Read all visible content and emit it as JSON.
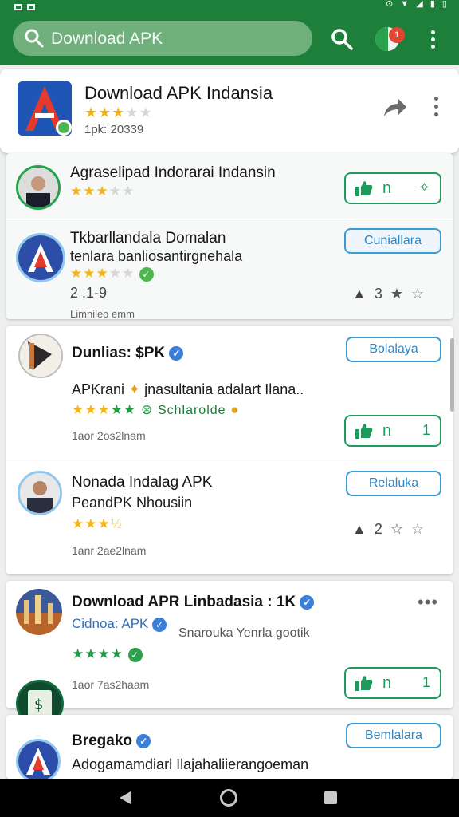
{
  "search": {
    "query": "Download APK"
  },
  "topbar": {
    "badge": "1"
  },
  "header": {
    "title": "Download APK Indansia",
    "stars": "★★★★★",
    "sub": "1pk: 20339"
  },
  "items": [
    {
      "title": "Agraselipad Indorarai Indansin",
      "stars": "★★★★★",
      "like_label": "n",
      "like_end": "✧"
    },
    {
      "title": "Tkbarllandala Domalan",
      "line2": "tenlara banliosantirgnehala",
      "stars": "★★★★★",
      "value": "2 .1-9",
      "meta": "Limnileo emm",
      "button": "Cuniallara",
      "react_count": "3"
    },
    {
      "title": "Dunlias: $PK",
      "line2": "APKrani",
      "line2b": "jnasultania adalart Ilana..",
      "stars": "★★★★★",
      "tag": "Schlarolde",
      "meta": "1aor 2os2lnam",
      "button": "Bolalaya",
      "like_label": "n",
      "like_end": "1"
    },
    {
      "title": "Nonada Indalag APK",
      "line2": "PeandPK Nhousiin",
      "stars": "★★★★",
      "meta": "1anr 2ae2lnam",
      "button": "Relaluka",
      "react_count": "2"
    },
    {
      "title": "Download APR Linbadasia : 1K",
      "line2": "Cidnoa: APK",
      "side": "Snarouka Yenrla gootik",
      "stars": "★★★★",
      "meta": "1aor 7as2haam",
      "like_label": "n",
      "like_end": "1"
    },
    {
      "title": "Bregako",
      "line2": "Adogamamdiarl Ilajahaliierangoeman",
      "button": "Bemlalara"
    }
  ],
  "colors": {
    "brand_green": "#1e7f3b",
    "accent_blue": "#3b9bd6",
    "star_yellow": "#f3b619",
    "like_green": "#1e9a5d"
  }
}
